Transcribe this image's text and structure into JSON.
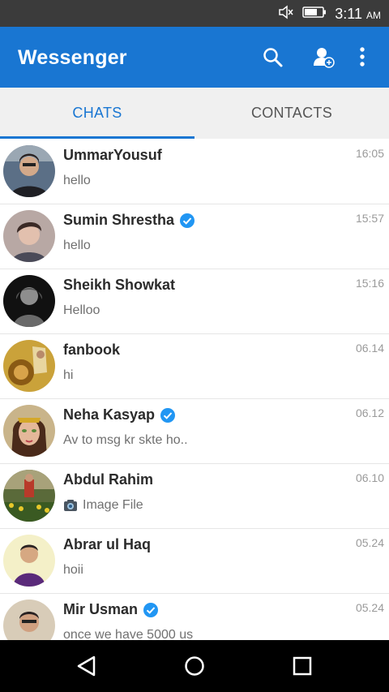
{
  "status": {
    "time": "3:11",
    "ampm": "AM"
  },
  "app": {
    "title": "Wessenger"
  },
  "tabs": [
    {
      "label": "CHATS"
    },
    {
      "label": "CONTACTS"
    }
  ],
  "chats": [
    {
      "name": "UmmarYousuf",
      "message": "hello",
      "time": "16:05"
    },
    {
      "name": "Sumin Shrestha",
      "message": "hello",
      "time": "15:57"
    },
    {
      "name": "Sheikh Showkat",
      "message": "Helloo",
      "time": "15:16"
    },
    {
      "name": "fanbook",
      "message": "hi",
      "time": "06.14"
    },
    {
      "name": "Neha Kasyap",
      "message": "Av to msg kr skte ho..",
      "time": "06.12"
    },
    {
      "name": "Abdul Rahim",
      "message": "Image File",
      "time": "06.10"
    },
    {
      "name": "Abrar ul Haq",
      "message": "hoii",
      "time": "05.24"
    },
    {
      "name": "Mir Usman",
      "message": "once we have 5000 us",
      "time": "05.24"
    }
  ],
  "colors": {
    "primary": "#1976d2",
    "verified": "#2196f3",
    "statusbar": "#3b3b3b"
  },
  "icons": [
    "mute-icon",
    "battery-icon",
    "search-icon",
    "add-contact-icon",
    "more-vert-icon",
    "verified-icon",
    "camera-icon",
    "back-icon",
    "home-icon",
    "recents-icon"
  ]
}
